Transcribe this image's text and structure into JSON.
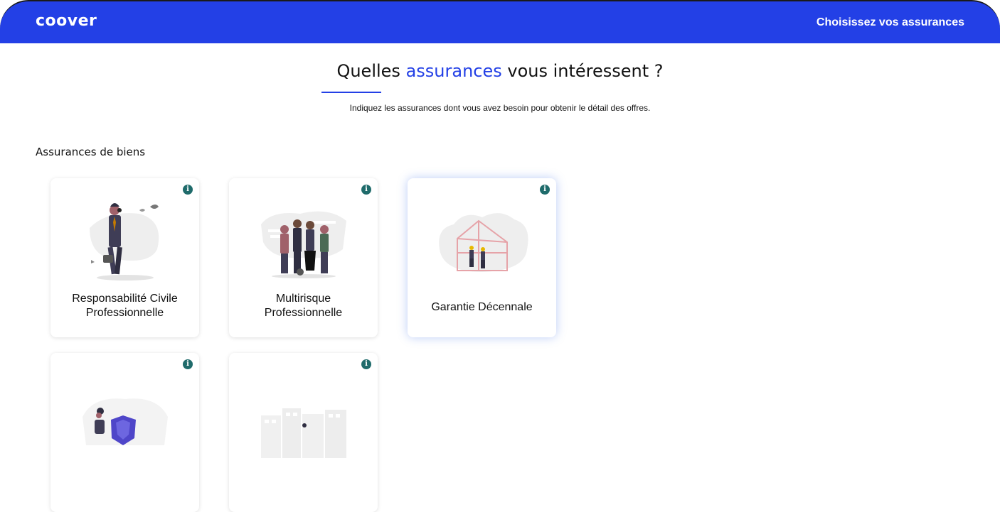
{
  "header": {
    "logo": "coover",
    "nav_link": "Choisissez vos assurances"
  },
  "page": {
    "title_part1": "Quelles ",
    "title_accent": "assurances",
    "title_part2": " vous intéressent ?",
    "subtitle": "Indiquez les assurances dont vous avez besoin pour obtenir le détail des offres."
  },
  "section": {
    "label": "Assurances de biens"
  },
  "cards": [
    {
      "label": "Responsabilité Civile Professionnelle",
      "info": "i",
      "illustration": "businessman-phone-illustration"
    },
    {
      "label": "Multirisque Professionnelle",
      "info": "i",
      "illustration": "team-group-illustration"
    },
    {
      "label": "Garantie Décennale",
      "info": "i",
      "illustration": "house-construction-illustration",
      "selected": true
    },
    {
      "label": "",
      "info": "i",
      "illustration": "person-shield-illustration"
    },
    {
      "label": "",
      "info": "i",
      "illustration": "buildings-illustration"
    }
  ],
  "colors": {
    "brand": "#2340e6",
    "info_icon": "#1f6b6b"
  }
}
